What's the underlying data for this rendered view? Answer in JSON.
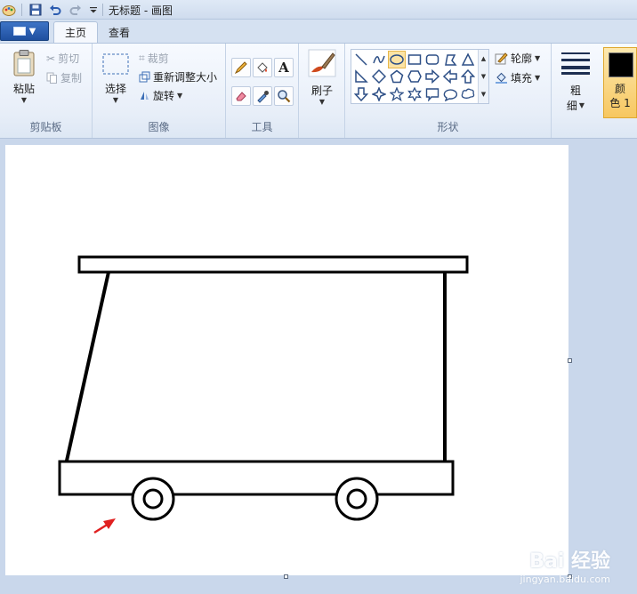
{
  "window": {
    "title": "无标题 - 画图"
  },
  "tabs": [
    {
      "label": "主页"
    },
    {
      "label": "查看"
    }
  ],
  "clipboard": {
    "paste": "粘贴",
    "cut": "剪切",
    "copy": "复制",
    "label": "剪贴板"
  },
  "image": {
    "select": "选择",
    "crop": "裁剪",
    "resize": "重新调整大小",
    "rotate": "旋转",
    "label": "图像"
  },
  "tools": {
    "label": "工具",
    "text_glyph": "A"
  },
  "brushes": {
    "label": "刷子"
  },
  "shapes": {
    "label": "形状",
    "outline": "轮廓",
    "fill": "填充"
  },
  "size": {
    "label_line1": "粗",
    "label_line2": "细"
  },
  "colors": {
    "color1_line1": "颜",
    "color1_line2": "色 1",
    "color1": "#000000"
  },
  "watermark": {
    "brand": "Bai 经验",
    "sub": "jingyan.baidu.com"
  },
  "theme": {
    "accent": "#1f4f9f",
    "selected": "#fbe3a5",
    "arrow": "#e02020"
  }
}
